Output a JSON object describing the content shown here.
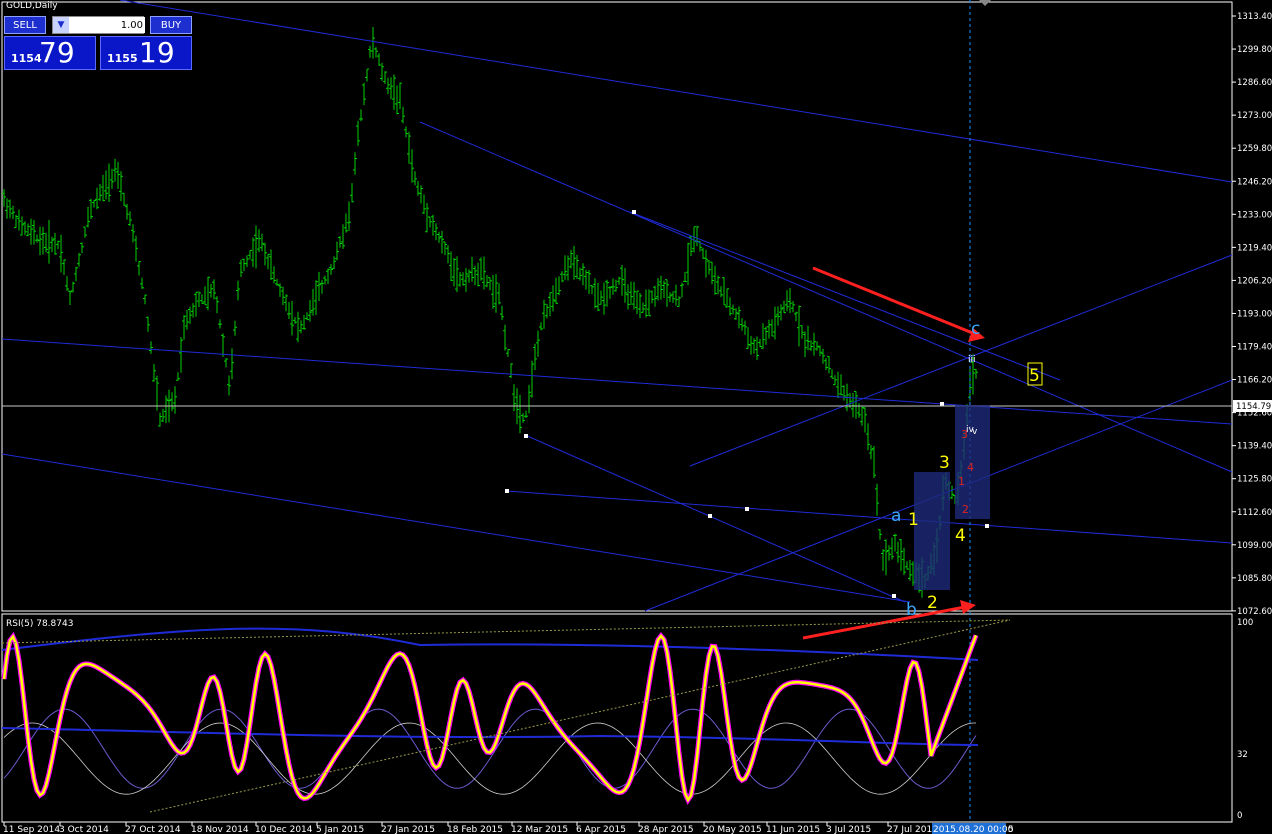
{
  "window": {
    "title": "GOLD,Daily"
  },
  "trade_panel": {
    "sell_label": "SELL",
    "buy_label": "BUY",
    "lot_value": "1.00",
    "sell_price_small": "1154",
    "sell_price_big": "79",
    "buy_price_small": "1155",
    "buy_price_big": "19"
  },
  "price_axis": {
    "labels": [
      "1313.40",
      "1299.80",
      "1286.60",
      "1273.00",
      "1259.80",
      "1246.20",
      "1233.00",
      "1219.40",
      "1206.20",
      "1193.00",
      "1179.40",
      "1166.20",
      "1152.60",
      "1139.40",
      "1125.80",
      "1112.60",
      "1099.00",
      "1085.80",
      "1072.60"
    ],
    "current_price": "1154.79"
  },
  "rsi": {
    "label": "RSI(5) 78.8743",
    "levels": [
      "100",
      "32",
      "0"
    ]
  },
  "time_axis": {
    "labels": [
      "11 Sep 2014",
      "3 Oct 2014",
      "27 Oct 2014",
      "18 Nov 2014",
      "10 Dec 2014",
      "5 Jan 2015",
      "27 Jan 2015",
      "18 Feb 2015",
      "12 Mar 2015",
      "6 Apr 2015",
      "28 Apr 2015",
      "20 May 2015",
      "11 Jun 2015",
      "3 Jul 2015",
      "27 Jul 2015"
    ],
    "cursor_label": "2015.08.20 00:00",
    "tail_label": "5"
  },
  "wave_labels": {
    "a": "a",
    "b": "b",
    "c": "c",
    "w1": "1",
    "w2": "2",
    "w3": "3",
    "w4": "4",
    "w5": "5",
    "m1": "1",
    "m2": "2",
    "m3": "3",
    "m4": "4",
    "iii": "iii",
    "iv": "iv",
    "v": "v"
  },
  "colors": {
    "candles": "#00d000",
    "trendlines": "#1f2bd6",
    "rsi_main": "#ffff00",
    "rsi_glow": "#ff00ff",
    "arrows": "#ff2020",
    "cursor": "#1e90ff",
    "yellow_labels": "#ffff00",
    "blue_labels": "#3aa7ff",
    "red_labels": "#e02020"
  }
}
